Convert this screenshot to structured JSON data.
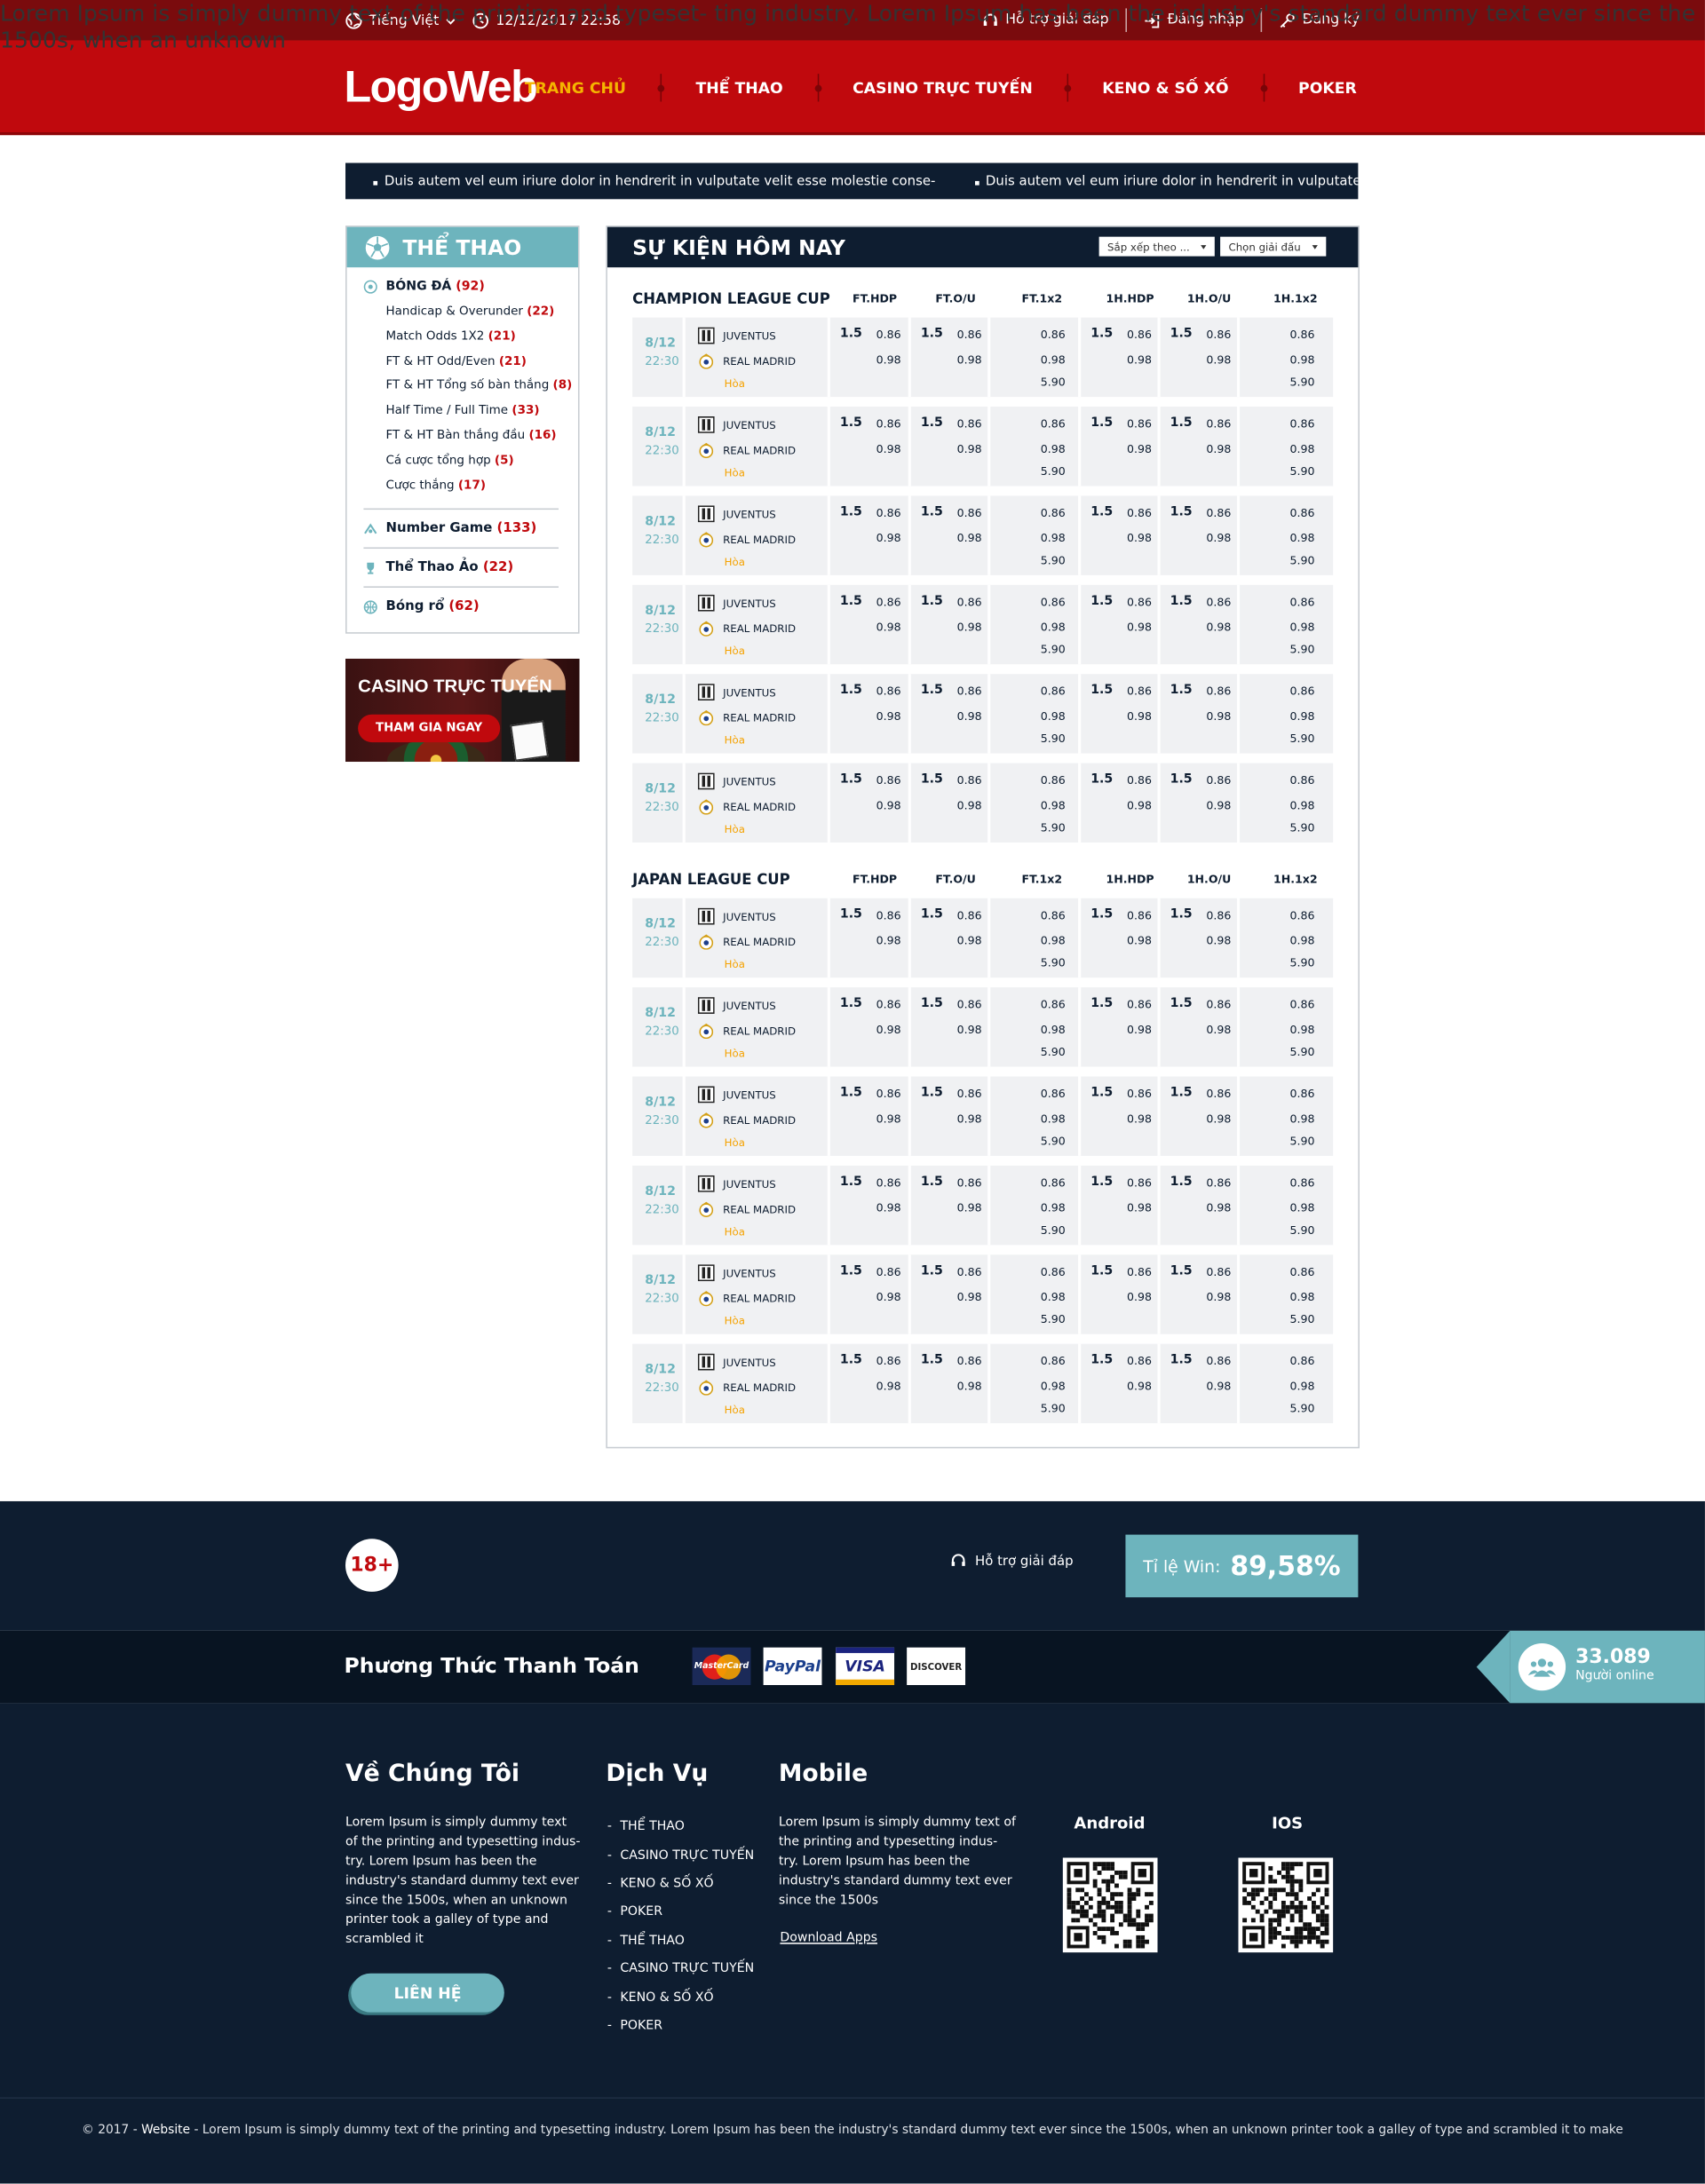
{
  "topbar": {
    "language": "Tiếng Việt",
    "datetime": "12/12/2017 22:58",
    "support": "Hỗ trợ giải đáp",
    "login": "Đăng nhập",
    "register": "Đăng ký"
  },
  "header": {
    "logo": "LogoWeb",
    "nav": [
      "TRANG CHỦ",
      "THỂ THAO",
      "CASINO TRỰC TUYẾN",
      "KENO & SỐ XỐ",
      "POKER"
    ],
    "active_nav": "TRANG CHỦ"
  },
  "ticker": [
    "Duis autem vel eum iriure dolor in hendrerit in vulputate velit esse molestie conse-",
    "Duis autem vel eum iriure dolor in hendrerit in vulputate"
  ],
  "sidebar": {
    "title": "THỂ THAO",
    "main_category": {
      "label": "BÓNG ĐÁ",
      "count": "(92)"
    },
    "sub_items": [
      {
        "label": "Handicap & Overunder",
        "count": "(22)"
      },
      {
        "label": "Match Odds 1X2",
        "count": "(21)"
      },
      {
        "label": "FT & HT Odd/Even",
        "count": "(21)"
      },
      {
        "label": "FT & HT Tổng số bàn thắng",
        "count": "(8)"
      },
      {
        "label": "Half Time / Full Time",
        "count": "(33)"
      },
      {
        "label": "FT & HT Bàn thắng đầu",
        "count": "(16)"
      },
      {
        "label": "Cá cược tổng hợp",
        "count": "(5)"
      },
      {
        "label": "Cược thắng",
        "count": "(17)"
      }
    ],
    "other_categories": [
      {
        "label": "Number Game",
        "count": "(133)",
        "icon": "number-game-icon"
      },
      {
        "label": "Thể Thao Ảo",
        "count": "(22)",
        "icon": "trophy-icon"
      },
      {
        "label": "Bóng rổ",
        "count": "(62)",
        "icon": "basketball-icon"
      }
    ]
  },
  "banner": {
    "title": "CASINO TRỰC TUYẾN",
    "button": "THAM GIA NGAY"
  },
  "events": {
    "title": "SỰ KIỆN HÔM NAY",
    "sort_select": "Sắp xếp theo ...",
    "league_select": "Chọn giải đấu",
    "columns": [
      "FT.HDP",
      "FT.O/U",
      "FT.1x2",
      "1H.HDP",
      "1H.O/U",
      "1H.1x2"
    ],
    "leagues": [
      {
        "name": "CHAMPION LEAGUE CUP",
        "match_count": 6
      },
      {
        "name": "JAPAN LEAGUE CUP",
        "match_count": 6
      }
    ],
    "match": {
      "date": "8/12",
      "time": "22:30",
      "home": "JUVENTUS",
      "away": "REAL MADRID",
      "draw": "Hòa",
      "hdp_line": "1.5",
      "odd_top": "0.86",
      "odd_bottom": "0.98",
      "odd_draw": "5.90"
    }
  },
  "footer": {
    "age": "18+",
    "desc": "Lorem Ipsum is simply dummy text of the printing and typeset- ting industry. Lorem Ipsum has been the industry's standard dummy text ever since the 1500s, when an unknown",
    "support": "Hỗ trợ giải đáp",
    "win_label": "Tỉ lệ Win:",
    "win_value": "89,58%",
    "payment_title": "Phương Thức Thanh Toán",
    "payments": [
      "MasterCard",
      "PayPal",
      "VISA",
      "DISCOVER"
    ],
    "online_count": "33.089",
    "online_label": "Người online",
    "about_title": "Về Chúng Tôi",
    "about_text": "Lorem Ipsum is simply dummy text of the printing and typesetting indus- try. Lorem Ipsum has been the industry's standard dummy text ever since the 1500s, when an unknown printer took a galley of type and scrambled it",
    "contact_button": "LIÊN HỆ",
    "services_title": "Dịch Vụ",
    "services": [
      "THỂ THAO",
      "CASINO TRỰC TUYẾN",
      "KENO & SỐ XỐ",
      "POKER",
      "THỂ THAO",
      "CASINO TRỰC TUYẾN",
      "KENO & SỐ XỐ",
      "POKER"
    ],
    "mobile_title": "Mobile",
    "mobile_text": "Lorem Ipsum is simply dummy text of the printing and typesetting indus- try. Lorem Ipsum has been the industry's standard dummy text ever since the 1500s",
    "download": "Download Apps",
    "android": "Android",
    "ios": "IOS",
    "copyright_year": "© 2017 -",
    "copyright_site": "Website",
    "copyright_text": "- Lorem Ipsum is simply dummy text of the printing and typesetting industry. Lorem Ipsum has been the industry's standard dummy text ever since the 1500s, when an unknown printer took a galley of type and scrambled it to make"
  },
  "colors": {
    "brand_red": "#c0090d",
    "dark_navy": "#0e1d30",
    "teal": "#6db4bd",
    "draw_orange": "#f5a200"
  }
}
